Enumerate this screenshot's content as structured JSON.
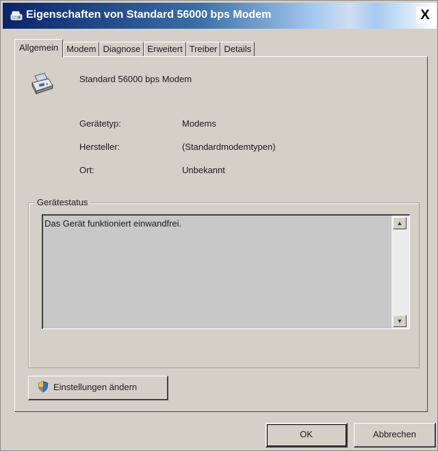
{
  "window": {
    "title": "Eigenschaften von Standard 56000 bps Modem",
    "close_label": "X"
  },
  "tabs": [
    {
      "label": "Allgemein",
      "active": true
    },
    {
      "label": "Modem",
      "active": false
    },
    {
      "label": "Diagnose",
      "active": false
    },
    {
      "label": "Erweitert",
      "active": false
    },
    {
      "label": "Treiber",
      "active": false
    },
    {
      "label": "Details",
      "active": false
    }
  ],
  "device": {
    "name": "Standard 56000 bps Modem",
    "icon": "modem-icon"
  },
  "properties": [
    {
      "label": "Gerätetyp:",
      "value": "Modems"
    },
    {
      "label": "Hersteller:",
      "value": "(Standardmodemtypen)"
    },
    {
      "label": "Ort:",
      "value": "Unbekannt"
    }
  ],
  "status": {
    "group_label": "Gerätestatus",
    "text": "Das Gerät funktioniert einwandfrei."
  },
  "buttons": {
    "settings": "Einstellungen ändern",
    "ok": "OK",
    "cancel": "Abbrechen"
  }
}
